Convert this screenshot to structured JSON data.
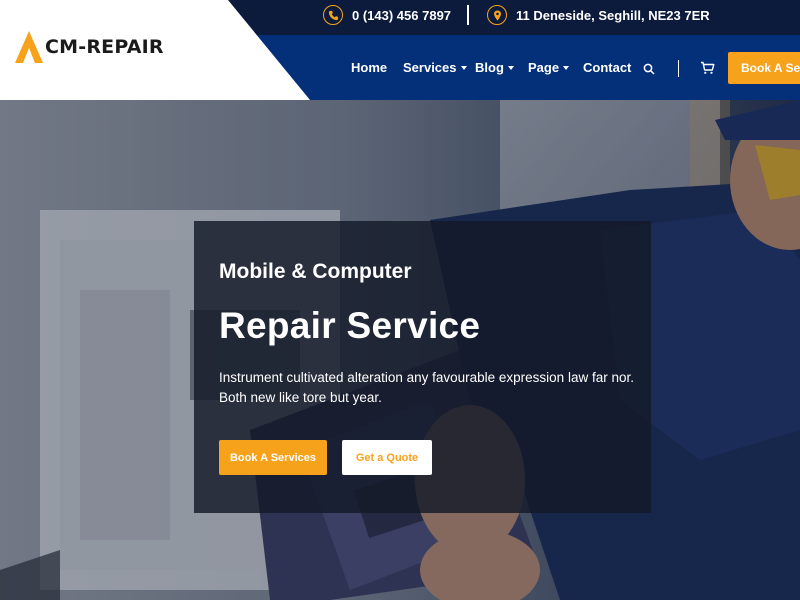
{
  "brand": {
    "name": "CM-REPAIR",
    "logo_icon": "triangle-logo-icon",
    "accent_color": "#f7a21b"
  },
  "topbar": {
    "phone": "0 (143) 456 7897",
    "phone_icon": "phone-icon",
    "address": "11 Deneside, Seghill, NE23 7ER",
    "address_icon": "location-pin-icon"
  },
  "nav": {
    "home": "Home",
    "services": "Services",
    "blog": "Blog",
    "page": "Page",
    "contact": "Contact",
    "search_icon": "search-icon",
    "cart_icon": "cart-icon",
    "book_button": "Book A Serv"
  },
  "colors": {
    "topbar": "#0c1b3c",
    "navbar": "#04307a",
    "accent": "#f7a21b"
  },
  "hero": {
    "subtitle": "Mobile & Computer",
    "title": "Repair Service",
    "description_line1": "Instrument cultivated alteration any favourable expression law far nor.",
    "description_line2": "Both new like tore but year.",
    "primary_button": "Book A Services",
    "secondary_button": "Get a Quote"
  }
}
